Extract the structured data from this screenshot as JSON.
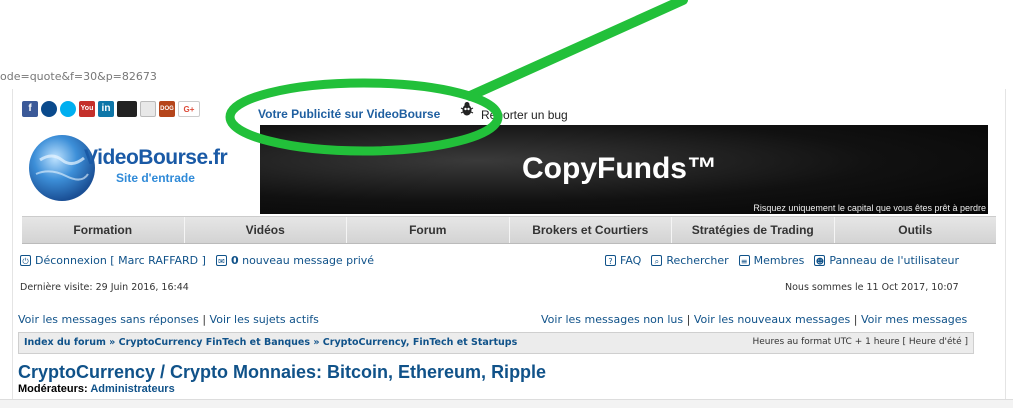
{
  "url_fragment": "ode=quote&f=30&p=82673",
  "social_icons": [
    "facebook-icon",
    "myspace-icon",
    "skype-icon",
    "youtube-icon",
    "linkedin-icon",
    "media-icon",
    "apps-icon",
    "dog-icon",
    "google-plus-icon"
  ],
  "social_labels": {
    "facebook": "f",
    "youtube": "You",
    "linkedin": "in",
    "dog": "DOG",
    "google_plus": "G+"
  },
  "header": {
    "promo_link": "Votre Publicité sur VideoBourse",
    "bug_link": "Reporter un bug",
    "logo_name": "VideoBourse.fr",
    "logo_tagline": "Site d'entrade"
  },
  "banner": {
    "title": "CopyFunds™",
    "note": "Risquez uniquement  le capital que vous êtes prêt à perdre"
  },
  "nav": [
    "Formation",
    "Vidéos",
    "Forum",
    "Brokers et Courtiers",
    "Stratégies de Trading",
    "Outils"
  ],
  "user_bar": {
    "logout": "Déconnexion [ Marc RAFFARD ]",
    "pm_count": "0",
    "pm_label": "nouveau message privé",
    "faq": "FAQ",
    "search": "Rechercher",
    "members": "Membres",
    "panel": "Panneau de l'utilisateur"
  },
  "last_visit": "Dernière visite: 29 Juin 2016, 16:44",
  "now": "Nous sommes le 11 Oct 2017, 10:07",
  "message_links_left": [
    "Voir les messages sans réponses",
    "Voir les sujets actifs"
  ],
  "message_links_right": [
    "Voir les messages non lus",
    "Voir les nouveaux messages",
    "Voir mes messages"
  ],
  "separator": "|",
  "breadcrumb": {
    "items": [
      "Index du forum",
      "CryptoCurrency FinTech et Banques",
      "CryptoCurrency, FinTech et Startups"
    ],
    "sep": "»",
    "timezone": "Heures au format UTC + 1 heure [ Heure d'été ]"
  },
  "forum": {
    "title": "CryptoCurrency / Crypto Monnaies: Bitcoin, Ethereum, Ripple",
    "moderators_label": "Modérateurs:",
    "moderators_value": "Administrateurs"
  },
  "colors": {
    "annotation": "#22c03a",
    "link": "#105289",
    "promo": "#1f5fa0"
  }
}
